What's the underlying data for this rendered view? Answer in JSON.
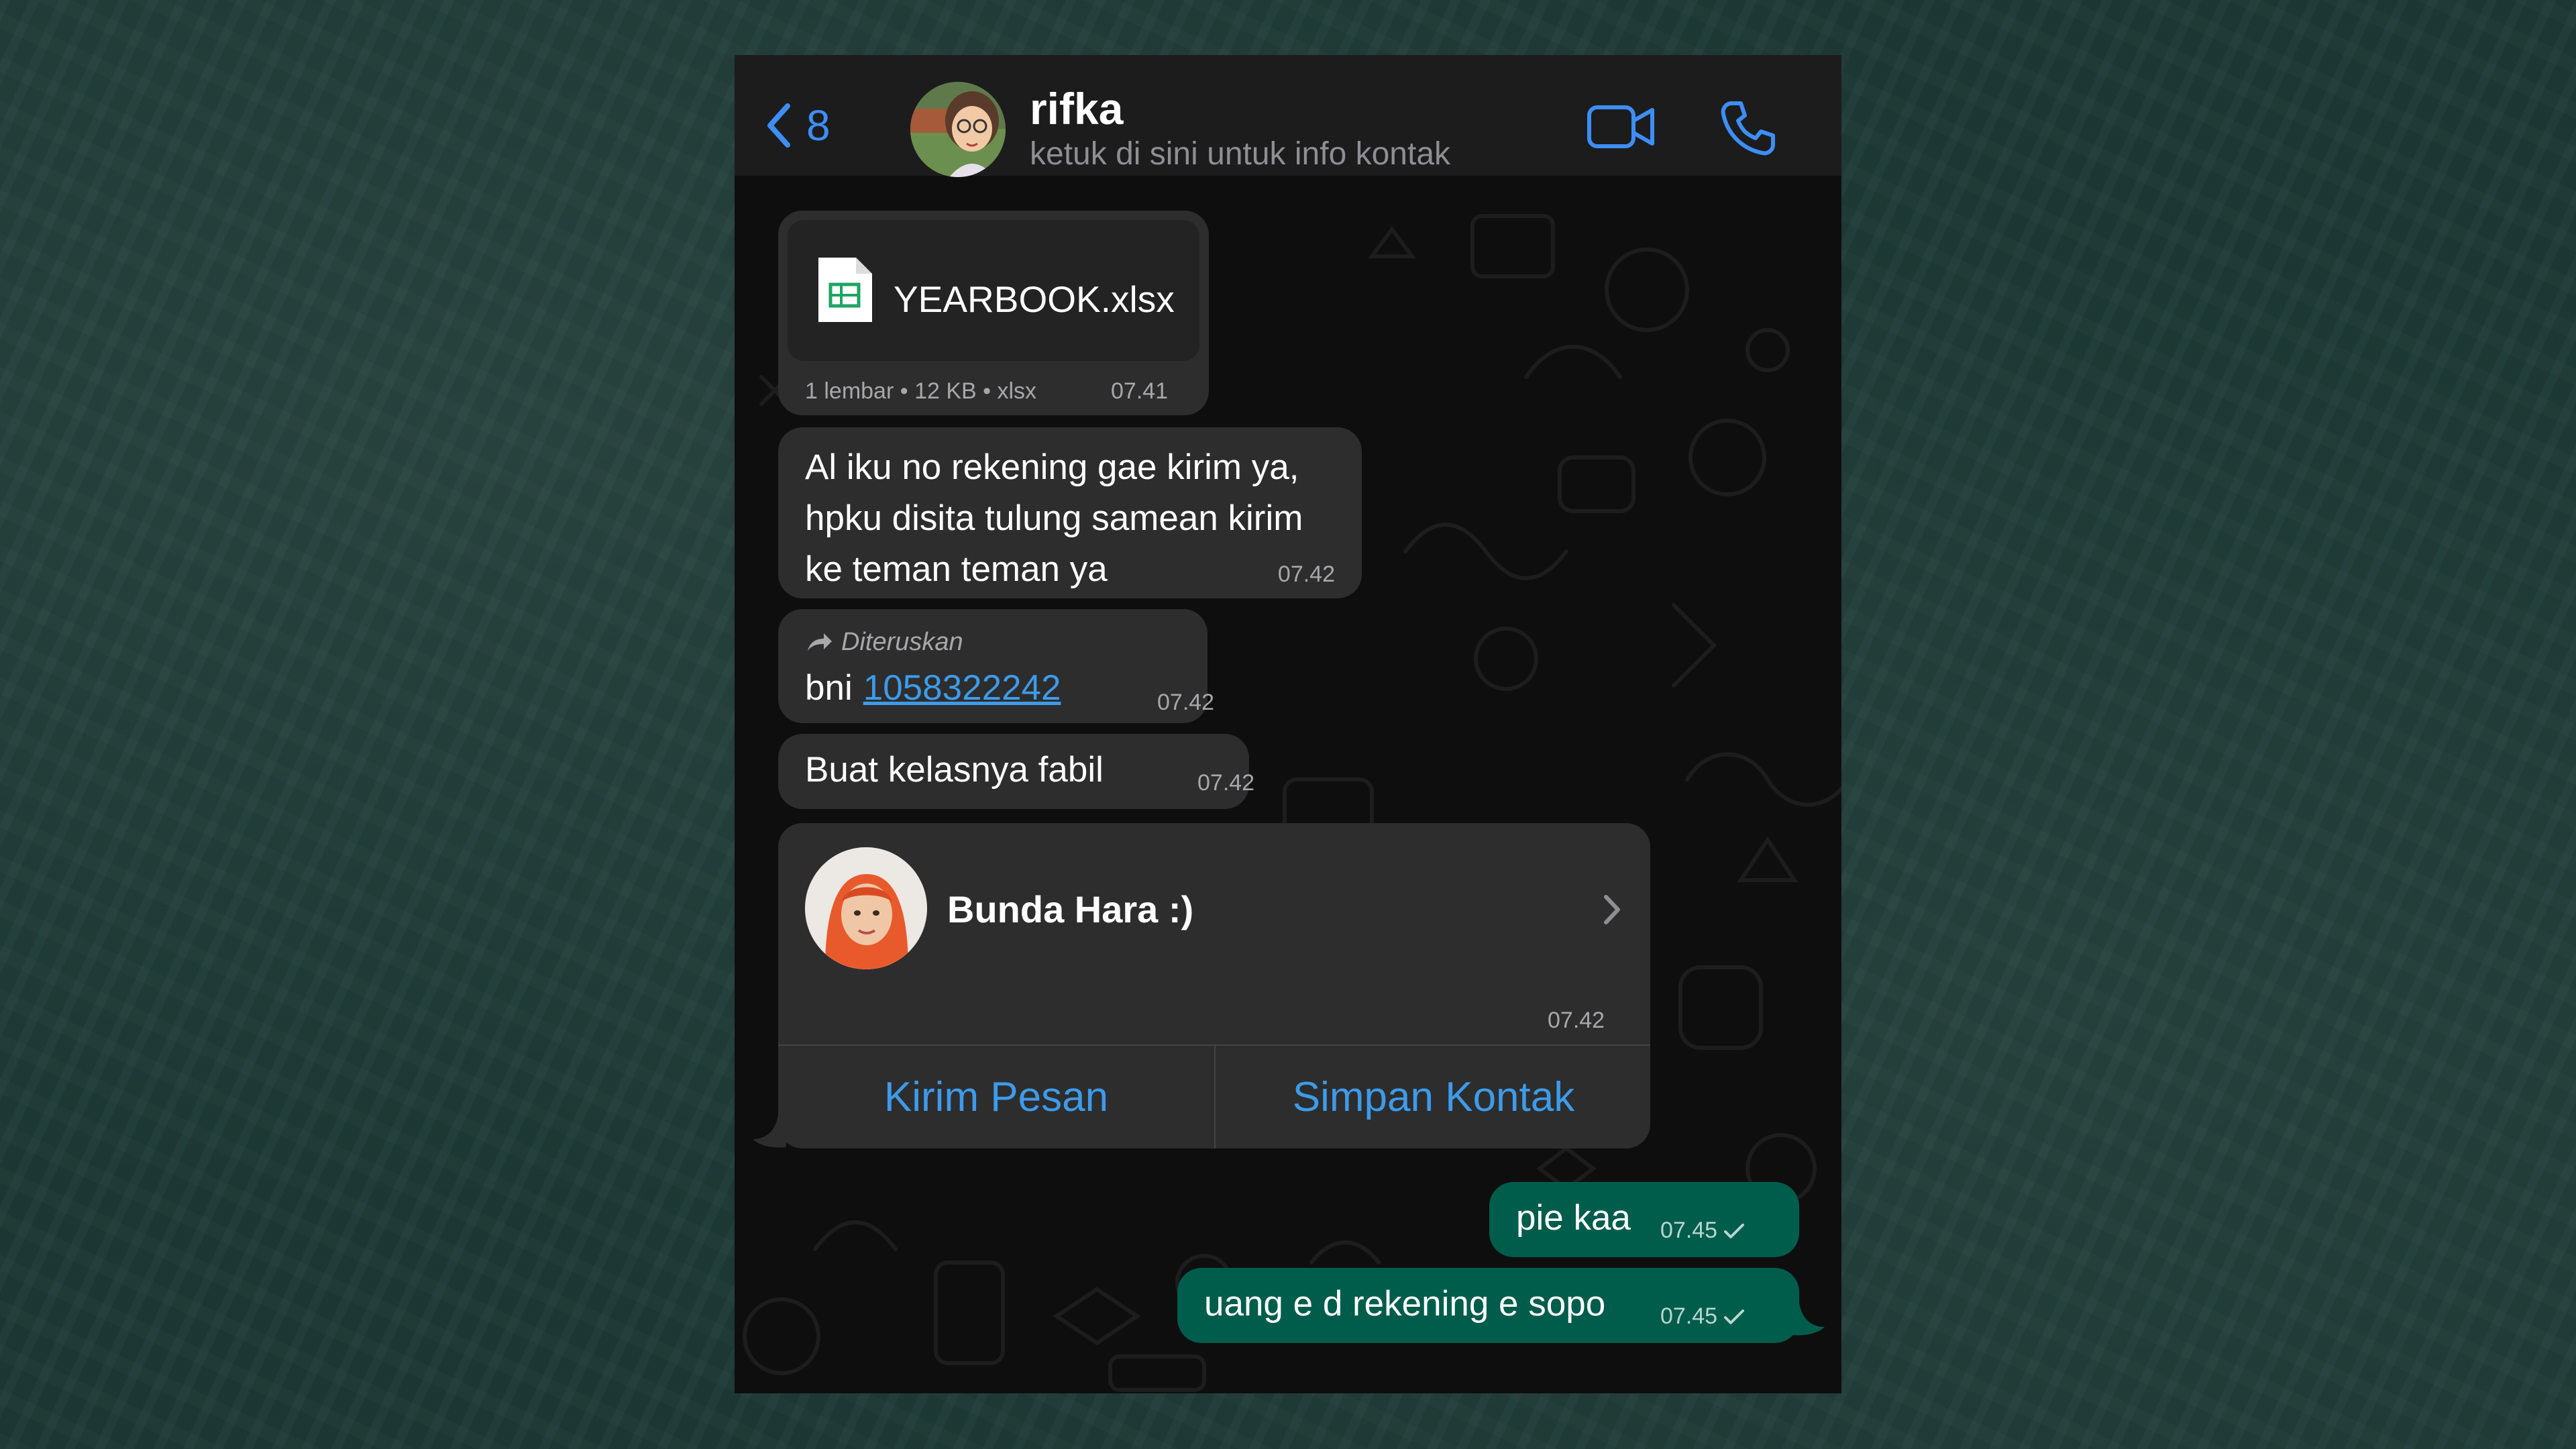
{
  "header": {
    "back_count": "8",
    "contact_name": "rifka",
    "contact_subtitle": "ketuk di sini untuk info kontak",
    "icons": {
      "back": "chevron-left-icon",
      "video": "video-camera-icon",
      "call": "phone-icon"
    }
  },
  "messages": {
    "document": {
      "file_name": "YEARBOOK.xlsx",
      "meta": "1 lembar • 12 KB • xlsx",
      "time": "07.41"
    },
    "msg1": {
      "text": "Al iku no rekening gae kirim ya, hpku disita tulung samean kirim ke teman teman ya",
      "time": "07.42"
    },
    "forwarded": {
      "label": "Diteruskan",
      "prefix": "bni",
      "number": "1058322242",
      "time": "07.42"
    },
    "msg3": {
      "text": "Buat kelasnya fabil",
      "time": "07.42"
    },
    "contact_card": {
      "name": "Bunda Hara :)",
      "time": "07.42",
      "send_message_label": "Kirim Pesan",
      "save_contact_label": "Simpan Kontak"
    },
    "out1": {
      "text": "pie kaa",
      "time": "07.45"
    },
    "out2": {
      "text": "uang e d rekening e sopo",
      "time": "07.45"
    }
  },
  "colors": {
    "accent_blue": "#3d8ef7",
    "link_blue": "#3d9be9",
    "incoming_bubble": "#2d2d2e",
    "outgoing_bubble": "#005c4b",
    "header_bg": "#1c1c1d",
    "page_bg": "#1e3a36"
  }
}
